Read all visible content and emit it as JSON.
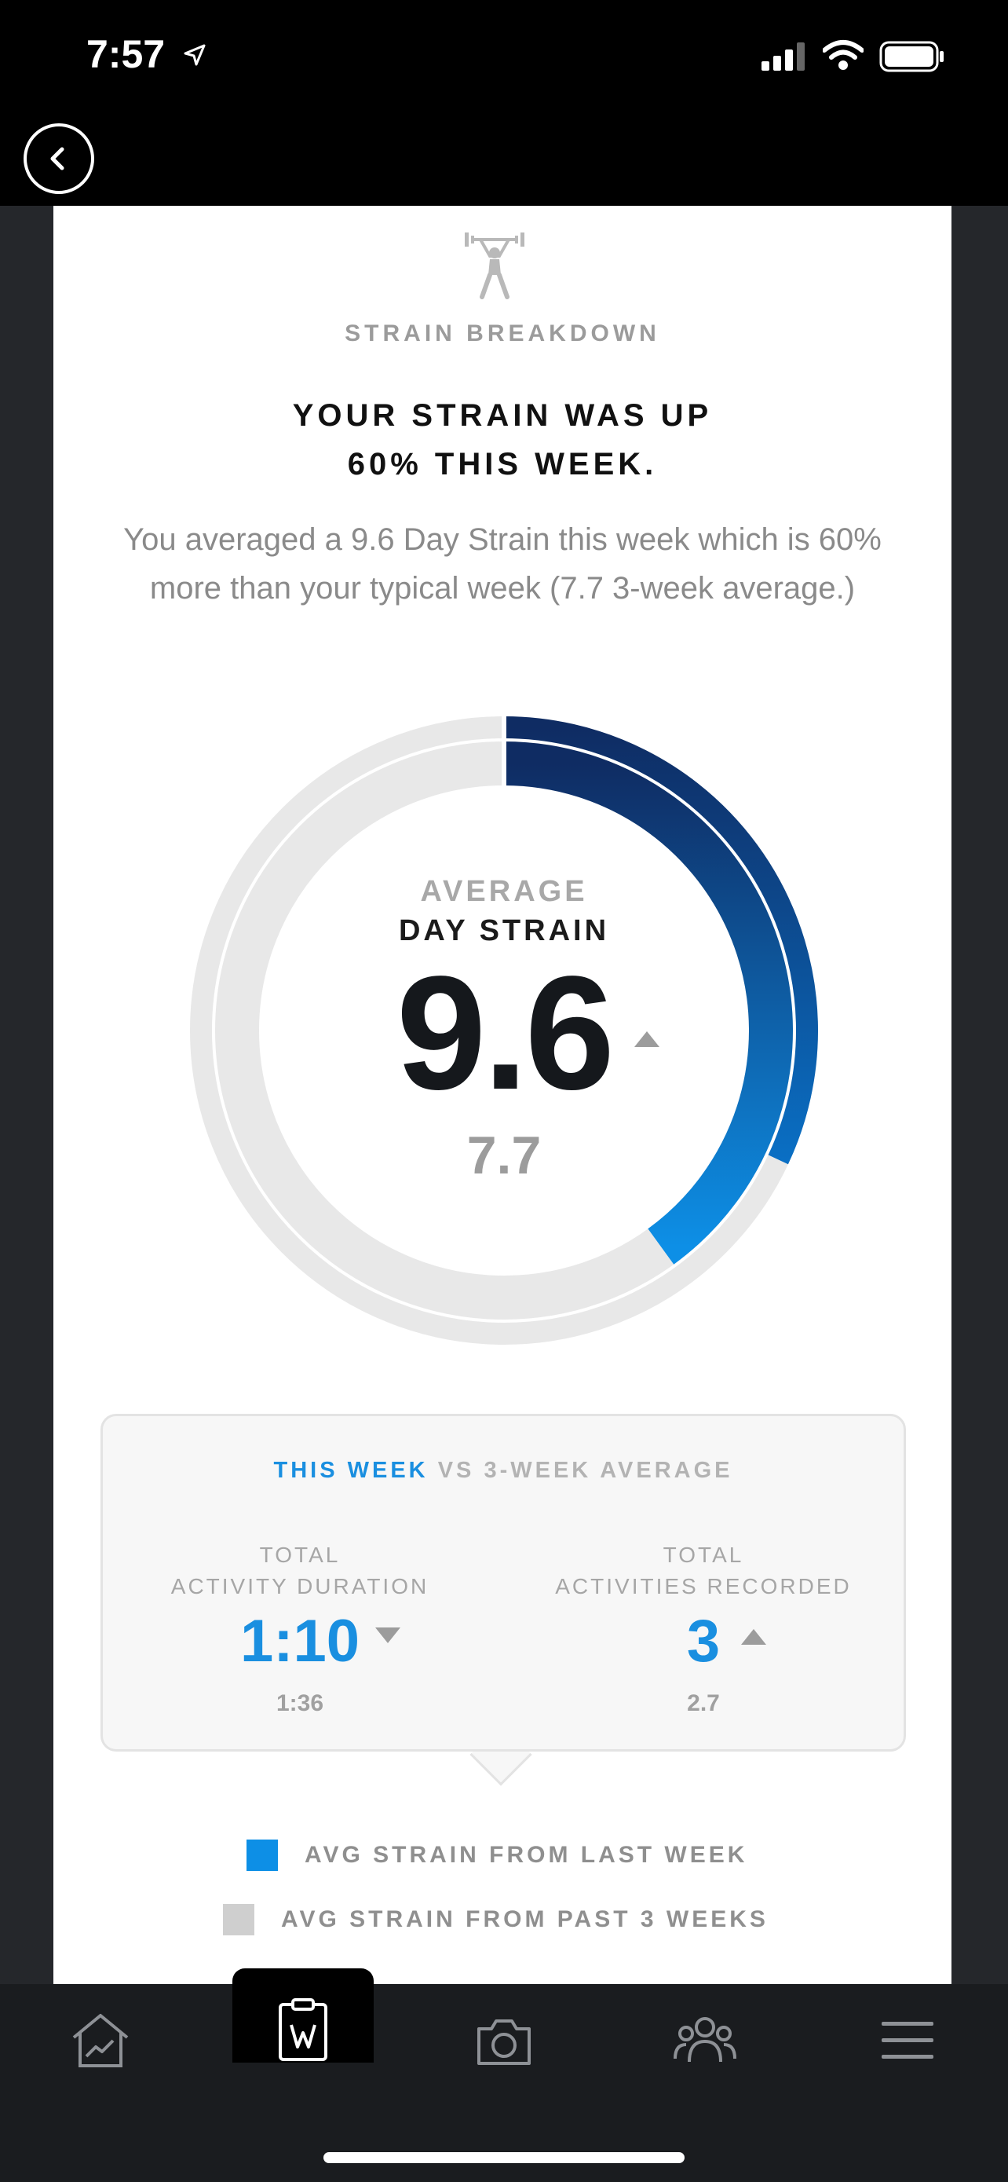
{
  "status_bar": {
    "time": "7:57"
  },
  "header": {
    "section_label": "STRAIN BREAKDOWN"
  },
  "headline": {
    "line1": "YOUR STRAIN WAS UP",
    "line2": "60% THIS WEEK."
  },
  "description": "You averaged a 9.6 Day Strain this week which is 60% more than your typical week (7.7 3-week average.)",
  "gauge": {
    "label_top": "AVERAGE",
    "label_bottom": "DAY STRAIN",
    "value": "9.6",
    "baseline": "7.7",
    "this_week_fraction": 0.4,
    "three_week_fraction": 0.32,
    "colors": {
      "accent_dark": "#0f2c63",
      "accent_light": "#0d8fe6",
      "track": "#e8e8e8"
    }
  },
  "comparison": {
    "header_this_week": "THIS WEEK",
    "header_vs": "VS 3-WEEK AVERAGE",
    "left": {
      "label1": "TOTAL",
      "label2": "ACTIVITY DURATION",
      "value": "1:10",
      "baseline": "1:36",
      "trend": "down"
    },
    "right": {
      "label1": "TOTAL",
      "label2": "ACTIVITIES RECORDED",
      "value": "3",
      "baseline": "2.7",
      "trend": "up"
    }
  },
  "legend": [
    {
      "label": "AVG STRAIN FROM LAST WEEK",
      "color": "#0d8fe6"
    },
    {
      "label": "AVG STRAIN FROM PAST 3 WEEKS",
      "color": "#cfcfcf"
    }
  ],
  "tabs": [
    {
      "name": "home",
      "icon": "home-chart-icon",
      "active": false
    },
    {
      "name": "journal",
      "icon": "clipboard-icon",
      "active": true
    },
    {
      "name": "camera",
      "icon": "camera-icon",
      "active": false
    },
    {
      "name": "community",
      "icon": "people-icon",
      "active": false
    },
    {
      "name": "menu",
      "icon": "hamburger-icon",
      "active": false
    }
  ]
}
